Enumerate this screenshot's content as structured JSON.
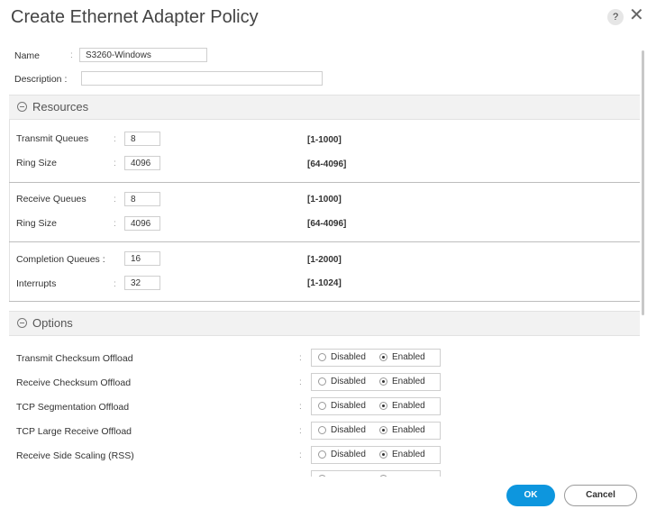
{
  "dialog": {
    "title": "Create Ethernet Adapter Policy",
    "help": "?",
    "close": "✕"
  },
  "name": {
    "label": "Name",
    "colon": ":",
    "value": "S3260-Windows"
  },
  "description": {
    "label": "Description :",
    "value": ""
  },
  "resources": {
    "title": "Resources",
    "rows": [
      {
        "label": "Transmit Queues",
        "colon": ":",
        "value": "8",
        "range": "[1-1000]"
      },
      {
        "label": "Ring Size",
        "colon": ":",
        "value": "4096",
        "range": "[64-4096]"
      },
      {
        "label": "Receive Queues",
        "colon": ":",
        "value": "8",
        "range": "[1-1000]"
      },
      {
        "label": "Ring Size",
        "colon": ":",
        "value": "4096",
        "range": "[64-4096]"
      },
      {
        "label": "Completion Queues :",
        "colon": "",
        "value": "16",
        "range": "[1-2000]"
      },
      {
        "label": "Interrupts",
        "colon": ":",
        "value": "32",
        "range": "[1-1024]"
      }
    ]
  },
  "options": {
    "title": "Options",
    "disabled_label": "Disabled",
    "enabled_label": "Enabled",
    "rows": [
      {
        "label": "Transmit Checksum Offload",
        "colon": ":",
        "selected": "Enabled"
      },
      {
        "label": "Receive Checksum Offload",
        "colon": ":",
        "selected": "Enabled"
      },
      {
        "label": "TCP Segmentation Offload",
        "colon": ":",
        "selected": "Enabled"
      },
      {
        "label": "TCP Large Receive Offload",
        "colon": ":",
        "selected": "Enabled"
      },
      {
        "label": "Receive Side Scaling (RSS)",
        "colon": ":",
        "selected": "Enabled"
      }
    ]
  },
  "footer": {
    "ok": "OK",
    "cancel": "Cancel"
  }
}
